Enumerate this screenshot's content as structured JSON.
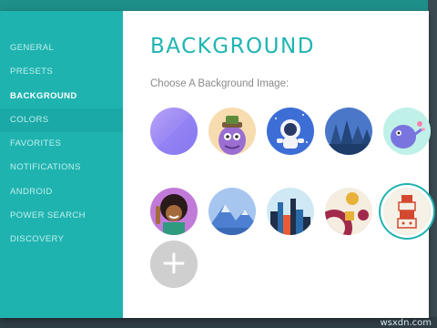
{
  "sidebar": {
    "items": [
      {
        "label": "GENERAL"
      },
      {
        "label": "PRESETS"
      },
      {
        "label": "BACKGROUND"
      },
      {
        "label": "COLORS"
      },
      {
        "label": "FAVORITES"
      },
      {
        "label": "NOTIFICATIONS"
      },
      {
        "label": "ANDROID"
      },
      {
        "label": "POWER SEARCH"
      },
      {
        "label": "DISCOVERY"
      }
    ],
    "active": "BACKGROUND"
  },
  "main": {
    "title": "BACKGROUND",
    "subtitle": "Choose A Background Image:",
    "thumbnails": [
      {
        "name": "gradient-purple",
        "selected": false
      },
      {
        "name": "monster-with-hat",
        "selected": false
      },
      {
        "name": "astronaut",
        "selected": false
      },
      {
        "name": "forest-night",
        "selected": false
      },
      {
        "name": "purple-creature",
        "selected": false
      },
      {
        "name": "girl-afro",
        "selected": false
      },
      {
        "name": "mountains",
        "selected": false
      },
      {
        "name": "city-skyline",
        "selected": false
      },
      {
        "name": "abstract-shapes",
        "selected": false
      },
      {
        "name": "totem-stack",
        "selected": true
      }
    ],
    "add_button_icon": "plus-icon"
  },
  "colors": {
    "accent": "#1fb3b0",
    "sidebar_bg": "#1fb3b0"
  },
  "watermark": "wsxdn.com"
}
